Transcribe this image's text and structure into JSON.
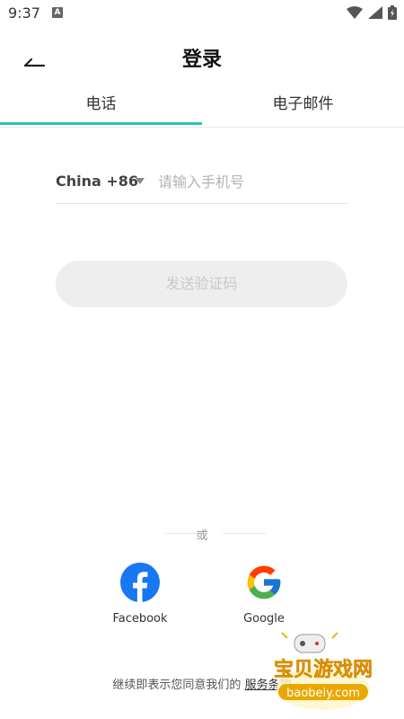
{
  "status_bar": {
    "time": "9:37",
    "notification_letter": "A",
    "icons": [
      "wifi-icon",
      "signal-icon",
      "battery-icon"
    ]
  },
  "header": {
    "title": "登录",
    "back_icon": "back-arrow-icon"
  },
  "tabs": [
    {
      "label": "电话",
      "active": true
    },
    {
      "label": "电子邮件",
      "active": false
    }
  ],
  "phone_form": {
    "country_code": "China +86",
    "placeholder": "请输入手机号",
    "value": ""
  },
  "send_button": {
    "label": "发送验证码",
    "enabled": false
  },
  "divider": {
    "label": "或"
  },
  "social_logins": [
    {
      "label": "Facebook",
      "icon": "facebook-icon",
      "color": "#1877F2"
    },
    {
      "label": "Google",
      "icon": "google-icon",
      "color": "#4285F4"
    }
  ],
  "terms": {
    "prefix": "继续即表示您同意我们的",
    "link": "服务条款"
  },
  "watermark": {
    "title": "宝贝游戏网",
    "url": "baobeiy.com"
  },
  "colors": {
    "accent": "#2cc3b7",
    "button_disabled_bg": "#eeeeee",
    "button_disabled_text": "#c9c9c9"
  }
}
